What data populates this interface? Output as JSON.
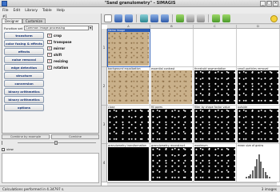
{
  "window": {
    "title": "\"Sand granulometry\" - SIMAGIS"
  },
  "menu": [
    "File",
    "Edit",
    "Library",
    "Table",
    "Help"
  ],
  "left": {
    "number": "#1",
    "tabs": [
      "Designer",
      "Customize"
    ],
    "function_set_label": "Function set",
    "function_set_value": "Common image processing",
    "categories": [
      "transform",
      "color fusing & effects",
      "effects",
      "noise removal",
      "edge detection",
      "structure",
      "conversion",
      "binary arithmetics",
      "binary arithmetics",
      "options"
    ],
    "functions": [
      "crop",
      "transpose",
      "mirror",
      "shift",
      "resizing",
      "rotation"
    ],
    "bottom_buttons": [
      "Combine by example",
      "Combine"
    ],
    "checkbox_label": "view"
  },
  "grid": {
    "columns": [
      "A",
      "B",
      "C",
      "D"
    ],
    "rows": [
      "1",
      "2",
      "3",
      "4"
    ],
    "cells": [
      [
        {
          "label": "Demo image",
          "img": "gray"
        },
        {
          "label": "",
          "img": "none"
        },
        {
          "label": "",
          "img": "none"
        },
        {
          "label": "",
          "img": "none"
        }
      ],
      [
        {
          "label": "background equalization",
          "img": "gray"
        },
        {
          "label": "essential contrast",
          "img": "gray"
        },
        {
          "label": "threshold segmentation",
          "img": "bin"
        },
        {
          "label": "small particles removal",
          "img": "bin"
        }
      ],
      [
        {
          "label": "close",
          "img": "bin"
        },
        {
          "label": "fill pores",
          "img": "bin"
        },
        {
          "label": "filter by shape factor value",
          "img": "bin"
        },
        {
          "label": "outside",
          "img": "bin"
        }
      ],
      [
        {
          "label": "granulometry transformation",
          "img": "black"
        },
        {
          "label": "granulometry reconstruct",
          "img": "bin"
        },
        {
          "label": "maximum",
          "img": "bin"
        },
        {
          "label": "mean size of grains",
          "img": "hist"
        }
      ]
    ],
    "histogram": [
      2,
      3,
      5,
      9,
      14,
      22,
      28,
      20,
      12,
      7,
      4,
      2
    ]
  },
  "status": {
    "left": "Calculations performed in 4.34797 s.",
    "right": "3 images"
  }
}
